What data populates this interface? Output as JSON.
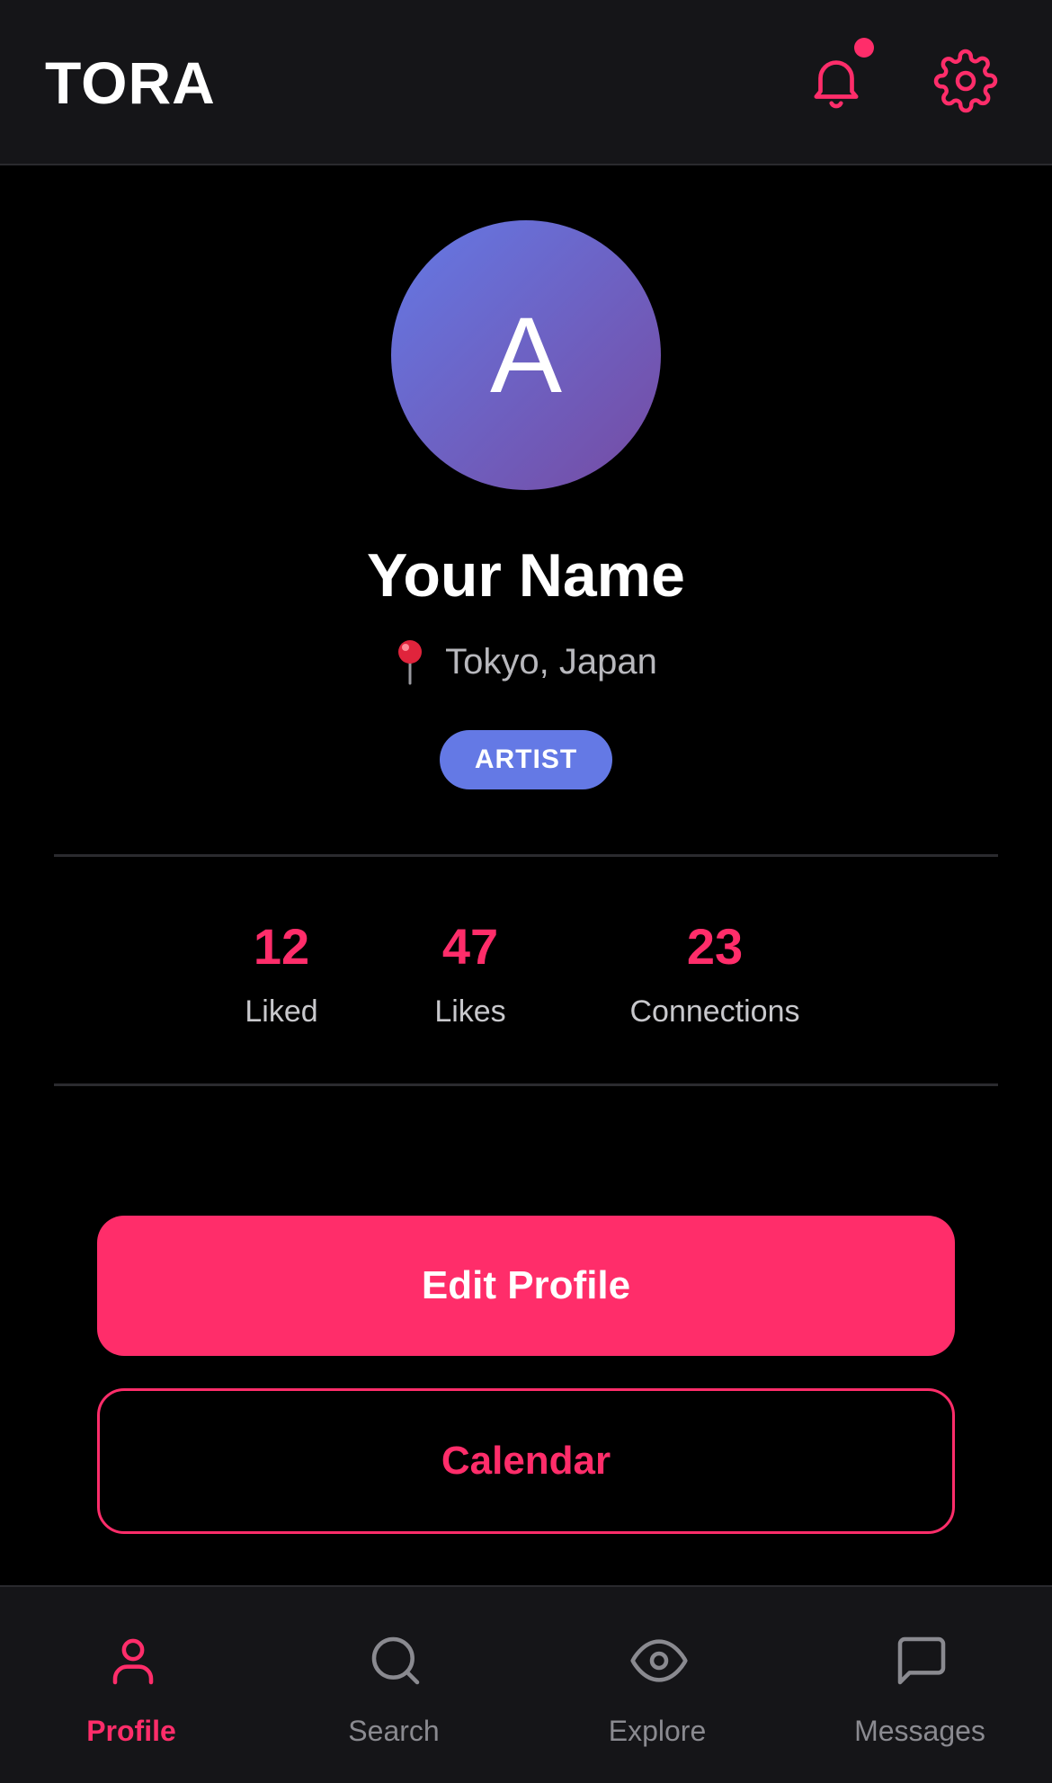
{
  "header": {
    "brand": "TORA",
    "notification_icon": "bell-icon",
    "settings_icon": "gear-icon",
    "has_unread_notifications": true
  },
  "profile": {
    "avatar_initial": "A",
    "name": "Your Name",
    "location_icon": "pushpin-icon",
    "location": "Tokyo, Japan",
    "role_badge": "ARTIST"
  },
  "stats": [
    {
      "value": "12",
      "label": "Liked"
    },
    {
      "value": "47",
      "label": "Likes"
    },
    {
      "value": "23",
      "label": "Connections"
    }
  ],
  "actions": {
    "edit_profile": "Edit Profile",
    "calendar": "Calendar"
  },
  "tabbar": {
    "active": "Profile",
    "tabs": [
      {
        "label": "Profile",
        "icon": "user-icon"
      },
      {
        "label": "Search",
        "icon": "search-icon"
      },
      {
        "label": "Explore",
        "icon": "eye-icon"
      },
      {
        "label": "Messages",
        "icon": "chat-bubble-icon"
      }
    ]
  },
  "colors": {
    "accent": "#ff2d6a",
    "badge": "#6479e5",
    "background": "#000000",
    "surface": "#151518"
  }
}
